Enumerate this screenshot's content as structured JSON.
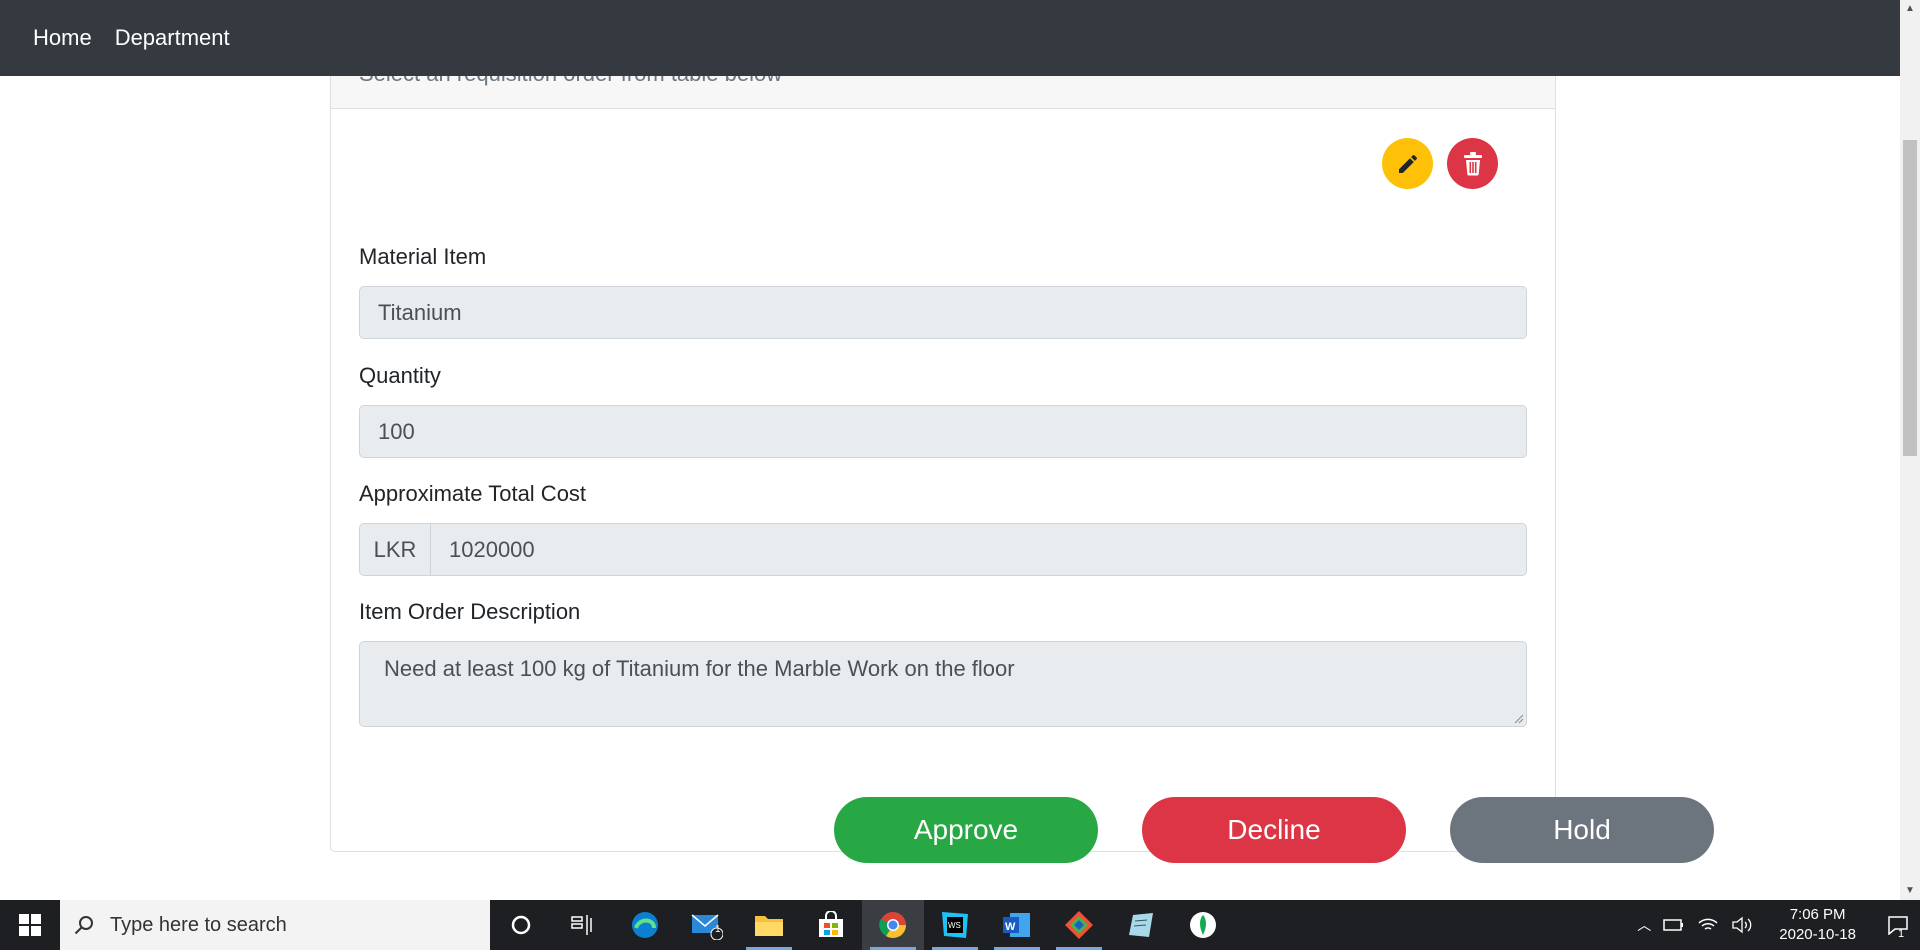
{
  "navbar": {
    "links": [
      "Home",
      "Department"
    ]
  },
  "card": {
    "header_text": "Select an requisition order from table below",
    "fields": {
      "material_item_label": "Material Item",
      "material_item_value": "Titanium",
      "quantity_label": "Quantity",
      "quantity_value": "100",
      "cost_label": "Approximate Total Cost",
      "cost_currency": "LKR",
      "cost_value": "1020000",
      "description_label": "Item Order Description",
      "description_value": "Need at least 100 kg of Titanium for the Marble Work on the floor"
    },
    "icons": {
      "edit": "pencil-icon",
      "delete": "trash-icon"
    },
    "actions": {
      "approve": "Approve",
      "decline": "Decline",
      "hold": "Hold"
    }
  },
  "taskbar": {
    "search_placeholder": "Type here to search",
    "mail_badge": "1",
    "notification_badge": "1",
    "time": "7:06 PM",
    "date": "2020-10-18"
  },
  "colors": {
    "navbar": "#343a40",
    "approve": "#28a745",
    "decline": "#dc3545",
    "hold": "#6c757d",
    "edit": "#ffc107"
  }
}
